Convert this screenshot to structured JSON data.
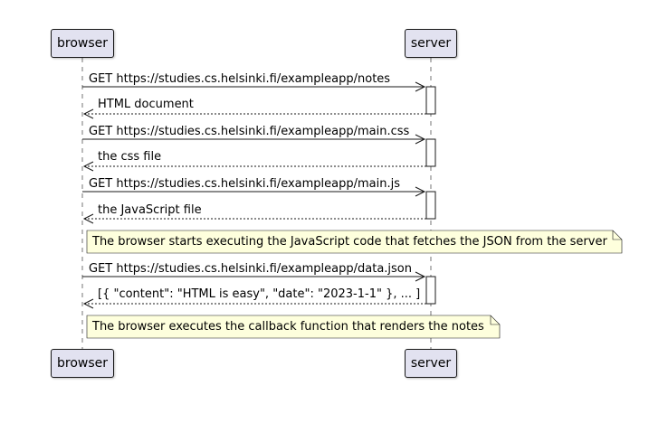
{
  "participants": {
    "left": "browser",
    "right": "server"
  },
  "messages": [
    {
      "text": "GET https://studies.cs.helsinki.fi/exampleapp/notes",
      "kind": "request"
    },
    {
      "text": "HTML document",
      "kind": "response"
    },
    {
      "text": "GET https://studies.cs.helsinki.fi/exampleapp/main.css",
      "kind": "request"
    },
    {
      "text": "the css file",
      "kind": "response"
    },
    {
      "text": "GET https://studies.cs.helsinki.fi/exampleapp/main.js",
      "kind": "request"
    },
    {
      "text": "the JavaScript file",
      "kind": "response"
    },
    {
      "text": "GET https://studies.cs.helsinki.fi/exampleapp/data.json",
      "kind": "request"
    },
    {
      "text": "[{ \"content\": \"HTML is easy\", \"date\": \"2023-1-1\" }, ... ]",
      "kind": "response"
    }
  ],
  "notes": [
    {
      "text": "The browser starts executing the JavaScript code that fetches the JSON from the server"
    },
    {
      "text": "The browser executes the callback function that renders the notes"
    }
  ],
  "colors": {
    "participant_fill": "#E2E2F0",
    "participant_border": "#181818",
    "note_fill": "#FEFFDD",
    "line": "#181818",
    "activation_fill": "#FFFFFF"
  }
}
